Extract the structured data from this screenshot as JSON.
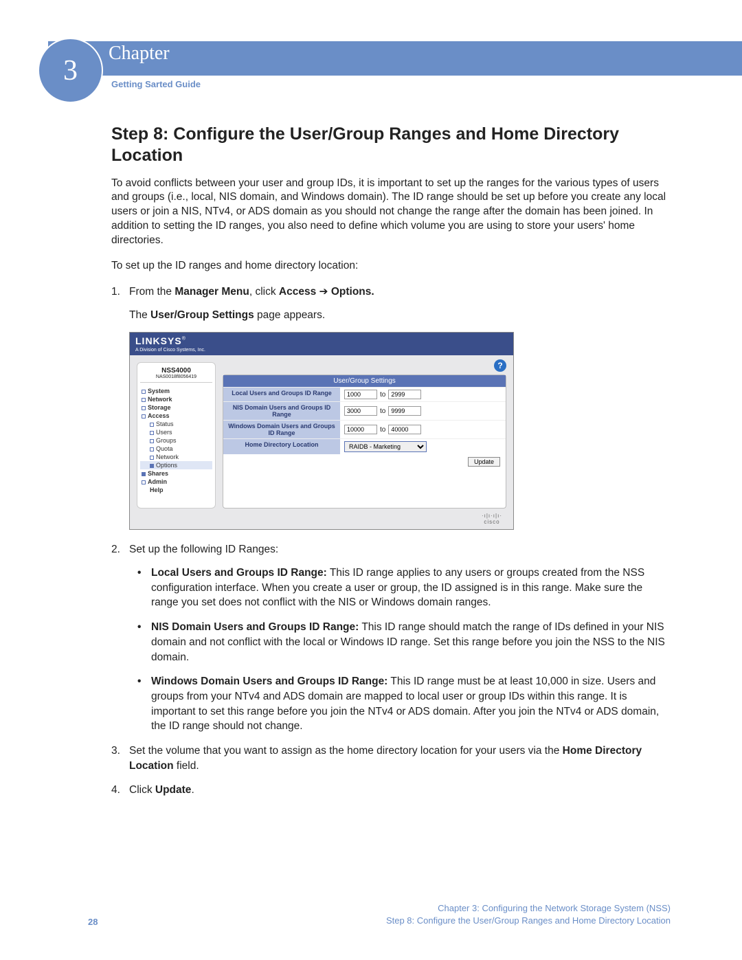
{
  "chapter": {
    "number": "3",
    "label": "Chapter",
    "guide": "Getting Sarted Guide"
  },
  "heading": "Step 8: Configure the User/Group Ranges and Home Directory Location",
  "intro": "To avoid conflicts between your user and group IDs, it is important to set up the ranges for the various types of users and groups (i.e., local, NIS domain, and Windows domain). The ID range should be set up before you create any local users or join a NIS, NTv4, or ADS domain as you should not change the range after the domain has been joined. In addition to setting the ID ranges, you also need to define which volume you are using to store your users' home directories.",
  "lead": "To set up the ID ranges and home directory location:",
  "steps": {
    "s1a": "From the ",
    "s1b": "Manager Menu",
    "s1c": ", click ",
    "s1d": "Access",
    "s1e": "Options.",
    "s1sub_a": "The ",
    "s1sub_b": "User/Group Settings",
    "s1sub_c": " page appears.",
    "s2": "Set up the following ID Ranges:",
    "b1t": "Local Users and Groups ID Range:",
    "b1": " This ID range applies to any users or groups created from the NSS configuration interface. When you create a user or group, the ID assigned is in this range. Make sure the range you set does not conflict with the NIS or Windows domain ranges.",
    "b2t": "NIS Domain Users and Groups ID Range:",
    "b2": " This ID range should match the range of IDs defined in your NIS domain and not conflict with the local or Windows ID range. Set this range before you join the NSS to the NIS domain.",
    "b3t": "Windows Domain Users and Groups ID Range:",
    "b3": " This ID range must be at least 10,000 in size. Users and groups from your NTv4 and ADS domain are mapped to local user or group IDs within this range. It is important to set this range before you join the NTv4 or ADS domain. After you join the NTv4 or ADS domain, the ID range should not change.",
    "s3a": "Set the volume that you want to assign as the home directory location for your users via the ",
    "s3b": "Home Directory Location",
    "s3c": " field.",
    "s4a": "Click ",
    "s4b": "Update",
    "s4c": "."
  },
  "embed": {
    "brand": "LINKSYS",
    "brand_sub": "A Division of Cisco Systems, Inc.",
    "device": "NSS4000",
    "mac": "NAS0018f8056419",
    "help": "?",
    "nav": {
      "system": "System",
      "network": "Network",
      "storage": "Storage",
      "access": "Access",
      "status": "Status",
      "users": "Users",
      "groups": "Groups",
      "quota": "Quota",
      "network2": "Network",
      "options": "Options",
      "shares": "Shares",
      "admin": "Admin",
      "help_item": "Help"
    },
    "panel": {
      "title": "User/Group Settings",
      "r1": "Local Users and Groups ID Range",
      "r2": "NIS Domain Users and Groups ID Range",
      "r3": "Windows Domain Users and Groups ID Range",
      "r4": "Home Directory Location",
      "to": "to",
      "v1a": "1000",
      "v1b": "2999",
      "v2a": "3000",
      "v2b": "9999",
      "v3a": "10000",
      "v3b": "40000",
      "home": "RAIDB - Marketing",
      "update": "Update"
    },
    "cisco": "cisco"
  },
  "footer": {
    "page": "28",
    "line1": "Chapter 3: Configuring the Network Storage System (NSS)",
    "line2": "Step 8: Configure the User/Group Ranges and Home Directory Location"
  }
}
